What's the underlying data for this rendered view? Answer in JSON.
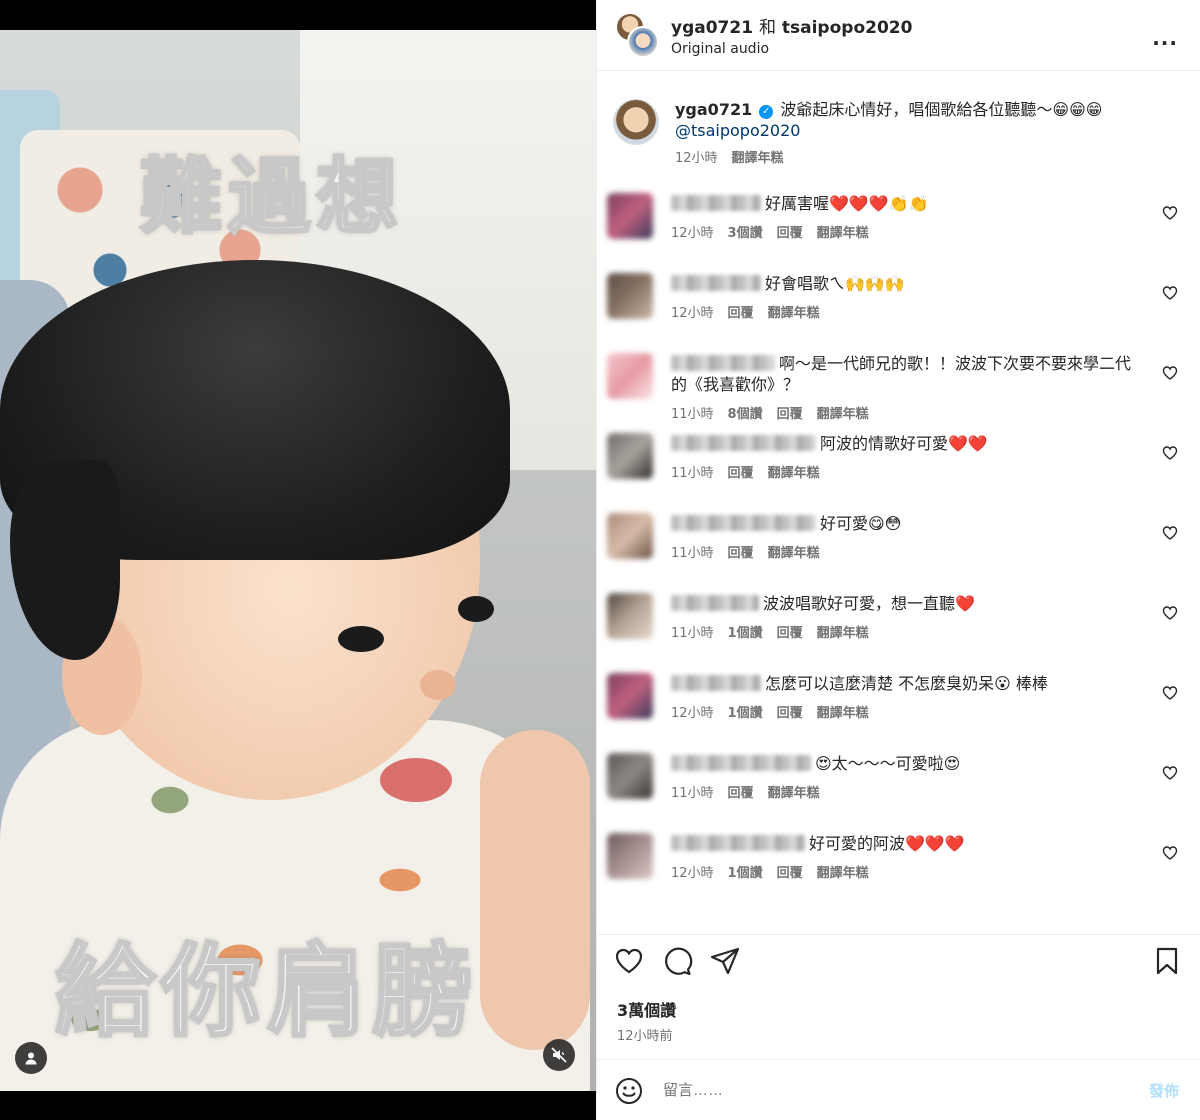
{
  "header": {
    "user1": "yga0721",
    "and": "和",
    "user2": "tsaipopo2020",
    "audio": "Original audio",
    "more": "..."
  },
  "video": {
    "caption_top": "難過想",
    "caption_bottom": "給你肩膀"
  },
  "post_caption": {
    "username": "yga0721",
    "text": "波爺起床心情好，唱個歌給各位聽聽～😁😁😁",
    "mention": "@tsaipopo2020",
    "time": "12小時",
    "translate": "翻譯年糕"
  },
  "comments": [
    {
      "name_width": 90,
      "text": "好厲害喔❤️❤️❤️👏👏",
      "time": "12小時",
      "likes": "3個讚",
      "reply": "回覆",
      "translate": "翻譯年糕",
      "avatar": [
        "#7a3f5e",
        "#c06080",
        "#3b3b5a"
      ]
    },
    {
      "name_width": 90,
      "text": "好會唱歌ㄟ🙌🙌🙌",
      "time": "12小時",
      "likes": "",
      "reply": "回覆",
      "translate": "翻譯年糕",
      "avatar": [
        "#5a4b42",
        "#8a7566",
        "#c9b8a8"
      ]
    },
    {
      "name_width": 104,
      "text": "啊～是一代師兄的歌！！波波下次要不要來學二代的《我喜歡你》？",
      "time": "11小時",
      "likes": "8個讚",
      "reply": "回覆",
      "translate": "翻譯年糕",
      "avatar": [
        "#f3c7cc",
        "#e69aa4",
        "#fbe3e5"
      ]
    },
    {
      "name_width": 145,
      "text": "阿波的情歌好可愛❤️❤️",
      "time": "11小時",
      "likes": "",
      "reply": "回覆",
      "translate": "翻譯年糕",
      "avatar": [
        "#6d6a67",
        "#a9a39d",
        "#2f2c2a"
      ]
    },
    {
      "name_width": 145,
      "text": "好可愛😋😳",
      "time": "11小時",
      "likes": "",
      "reply": "回覆",
      "translate": "翻譯年糕",
      "avatar": [
        "#a98a78",
        "#d6bba7",
        "#6b5446"
      ]
    },
    {
      "name_width": 88,
      "text": "波波唱歌好可愛，想一直聽❤️",
      "time": "11小時",
      "likes": "1個讚",
      "reply": "回覆",
      "translate": "翻譯年糕",
      "avatar": [
        "#4e4640",
        "#b7a596",
        "#e3d6ca"
      ]
    },
    {
      "name_width": 90,
      "text": "怎麼可以這麼清楚 不怎麼臭奶呆😮 棒棒",
      "time": "12小時",
      "likes": "1個讚",
      "reply": "回覆",
      "translate": "翻譯年糕",
      "avatar": [
        "#7a3f5e",
        "#c06080",
        "#3b3b5a"
      ]
    },
    {
      "name_width": 140,
      "text": "😍太～～～可愛啦😍",
      "time": "11小時",
      "likes": "",
      "reply": "回覆",
      "translate": "翻譯年糕",
      "avatar": [
        "#5a5656",
        "#8e8884",
        "#3a3433"
      ]
    },
    {
      "name_width": 134,
      "text": "好可愛的阿波❤️❤️❤️",
      "time": "12小時",
      "likes": "1個讚",
      "reply": "回覆",
      "translate": "翻譯年糕",
      "avatar": [
        "#6b5a5a",
        "#a89090",
        "#d9c8c4"
      ]
    }
  ],
  "actions": {
    "likes": "3萬個讚",
    "posted": "12小時前",
    "comment_placeholder": "留言……",
    "send": "發佈"
  },
  "icons": [
    "user-icon",
    "mute-icon",
    "heart-icon",
    "comment-icon",
    "share-icon",
    "bookmark-icon",
    "emoji-icon",
    "more-icon"
  ],
  "colors": {
    "accent": "#0095f6",
    "send_disabled": "#b2dffc",
    "mention": "#00376b",
    "secondary_text": "#737373"
  }
}
